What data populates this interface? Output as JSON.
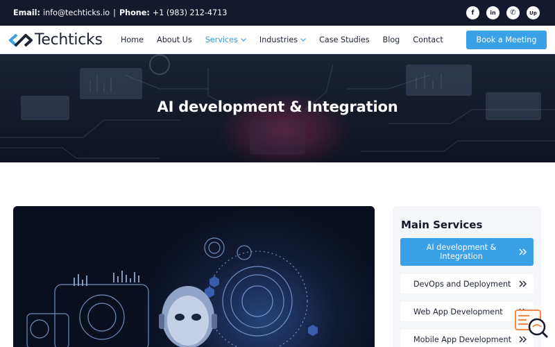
{
  "topbar": {
    "email_label": "Email:",
    "email": "info@techticks.io",
    "separator": "|",
    "phone_label": "Phone:",
    "phone": "+1 (983) 212-4713",
    "socials": [
      {
        "icon": "facebook-icon",
        "glyph": "f"
      },
      {
        "icon": "linkedin-icon",
        "glyph": "in"
      },
      {
        "icon": "whatsapp-icon",
        "glyph": "✆"
      },
      {
        "icon": "upwork-icon",
        "glyph": "Up"
      }
    ]
  },
  "header": {
    "logo_text": "Techticks",
    "nav": {
      "home": "Home",
      "about": "About Us",
      "services": "Services",
      "industries": "Industries",
      "case_studies": "Case Studies",
      "blog": "Blog",
      "contact": "Contact"
    },
    "book_label": "Book a Meeting"
  },
  "hero": {
    "title": "AI development & Integration"
  },
  "sidebar": {
    "title": "Main Services",
    "items": [
      {
        "label": "AI development & Integration",
        "active": true
      },
      {
        "label": "DevOps and Deployment",
        "active": false
      },
      {
        "label": "Web App Development",
        "active": false
      },
      {
        "label": "Mobile App Development",
        "active": false
      }
    ]
  },
  "colors": {
    "accent": "#3aa1e6",
    "nav_active": "#2f9be7",
    "dark": "#14192e",
    "chat_orange": "#f0884a"
  }
}
